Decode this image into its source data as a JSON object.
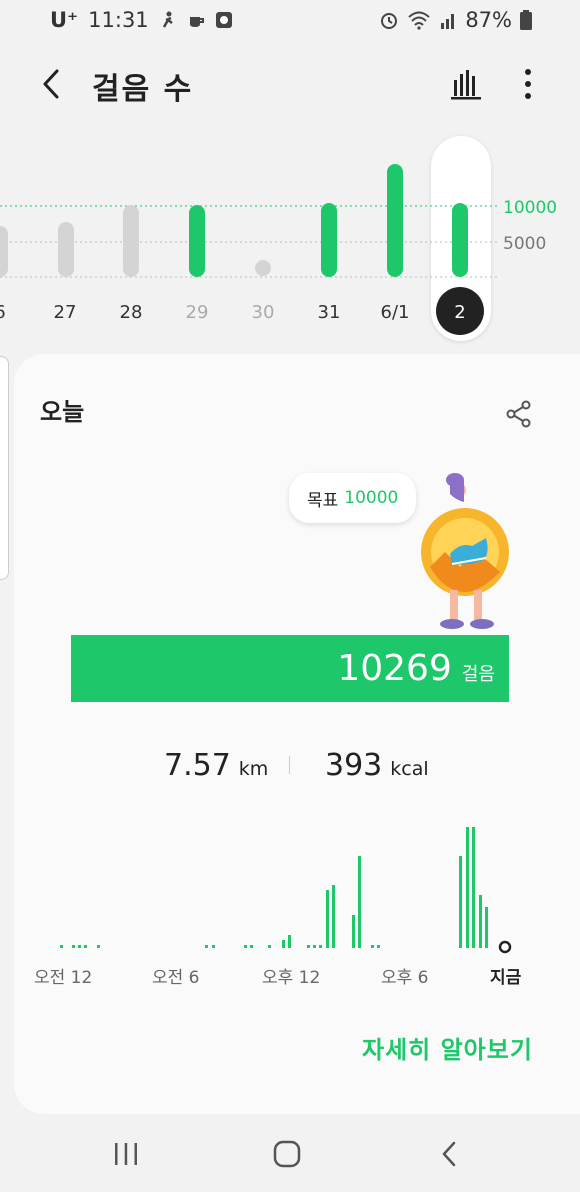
{
  "status_bar": {
    "carrier": "U⁺",
    "time": "11:31",
    "battery": "87%",
    "left_icons": [
      "runner-icon",
      "coffee-icon",
      "app-icon"
    ],
    "right_icons": [
      "alarm-icon",
      "wifi-icon",
      "signal-icon",
      "battery-icon"
    ]
  },
  "app_bar": {
    "title": "걸음 수",
    "back_icon": "chevron-left-icon",
    "stats_icon": "bar-chart-icon",
    "more_icon": "more-vert-icon"
  },
  "week_chart": {
    "days": [
      "6",
      "27",
      "28",
      "29",
      "30",
      "31",
      "6/1",
      "2"
    ],
    "selected_day": "2",
    "y_labels": [
      "10000",
      "5000"
    ],
    "accent": "#1ec86a",
    "inactive": "#d4d4d4"
  },
  "today": {
    "label": "오늘",
    "share_icon": "share-icon",
    "goal_label": "목표",
    "goal_value": "10000",
    "steps": "10269",
    "steps_unit": "걸음",
    "distance": "7.57",
    "distance_unit": "km",
    "calories": "393",
    "calories_unit": "kcal",
    "time_labels": [
      "오전 12",
      "오전 6",
      "오후 12",
      "오후 6"
    ],
    "now_label": "지금",
    "more_link": "자세히 알아보기"
  },
  "nav_bar": {
    "icons": [
      "recent-apps-icon",
      "home-icon",
      "back-icon"
    ]
  },
  "colors": {
    "accent": "#1ec86a",
    "background": "#f2f2f2",
    "card": "#fafafa"
  }
}
